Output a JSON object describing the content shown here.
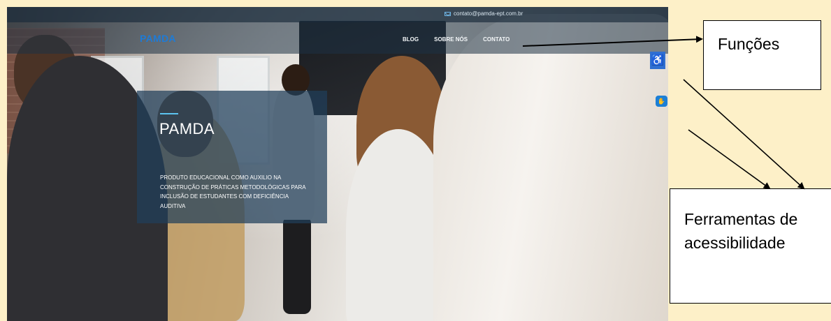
{
  "site": {
    "email": "contato@pamda-ept.com.br",
    "logo": "PAMDA",
    "nav": {
      "blog": "BLOG",
      "sobre": "SOBRE NÓS",
      "contato": "CONTATO"
    },
    "hero": {
      "title": "PAMDA",
      "description": "PRODUTO EDUCACIONAL COMO AUXILIO NA CONSTRUÇÃO DE PRÁTICAS METODOLÓGICAS PARA INCLUSÃO DE ESTUDANTES COM DEFICIÊNCIA AUDITIVA"
    },
    "accessibility_icon": "wheelchair-icon",
    "libras_icon": "hand-icon"
  },
  "annotations": {
    "functions_label": "Funções",
    "tools_label": "Ferramentas de acessibilidade"
  },
  "colors": {
    "accent": "#1e7bd6",
    "hero_line": "#5cc4ef",
    "page_background": "#fdf0c8"
  }
}
